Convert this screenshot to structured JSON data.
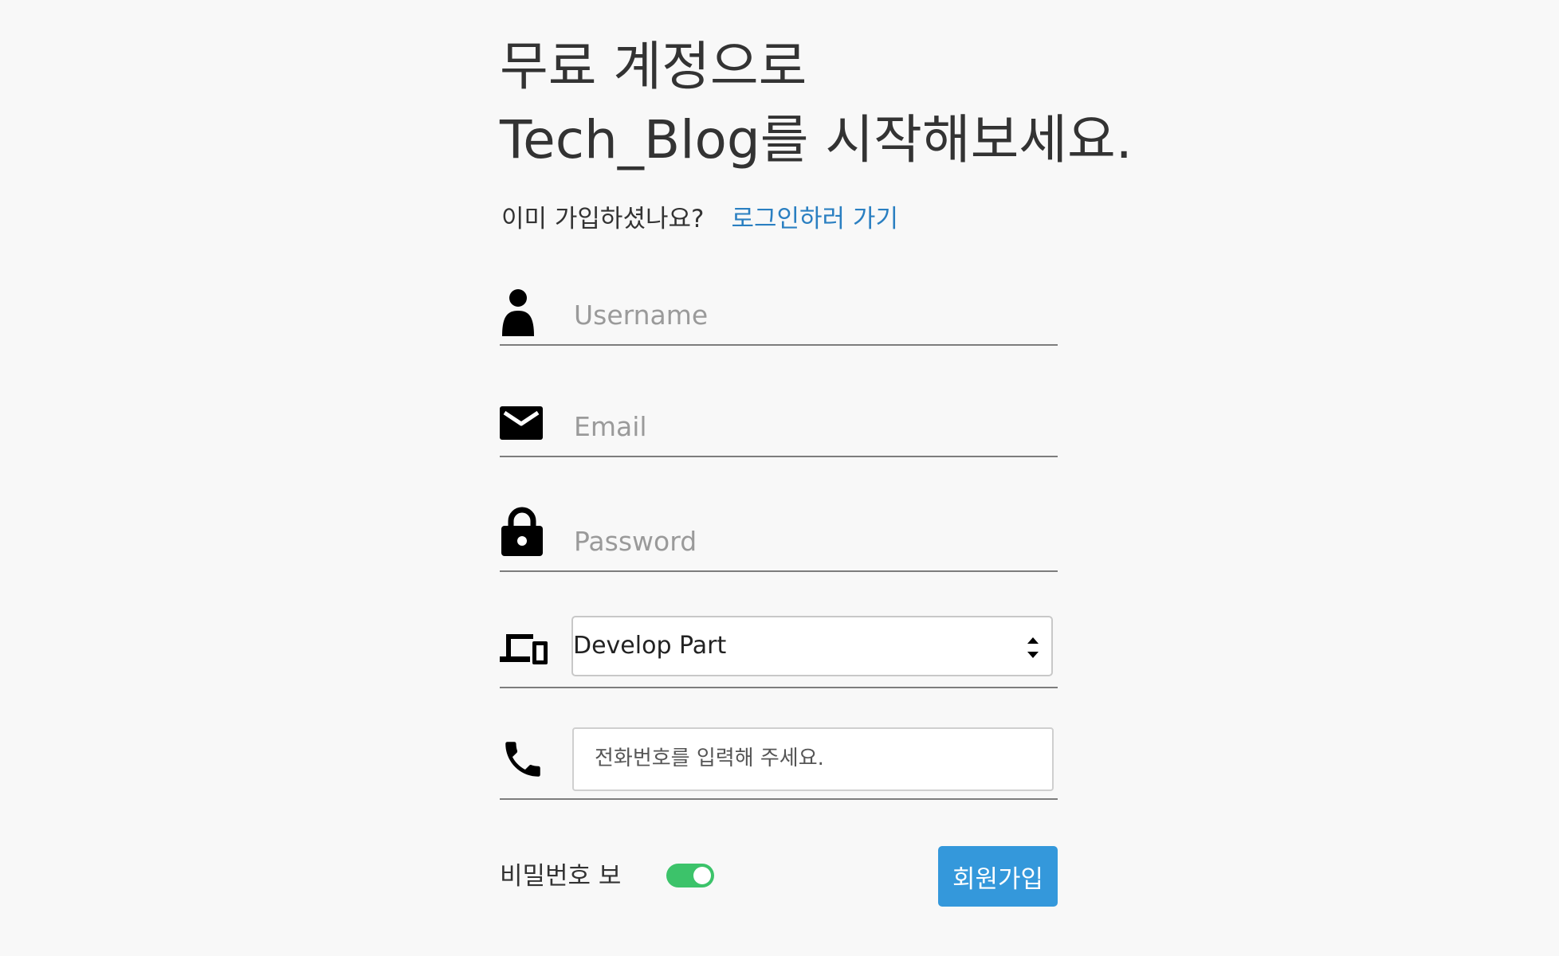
{
  "header": {
    "title_line1": "무료 계정으로",
    "title_line2": "Tech_Blog를 시작해보세요."
  },
  "login_prompt": {
    "question": "이미 가입하셨나요?",
    "link_label": "로그인하러 가기"
  },
  "form": {
    "username": {
      "placeholder": "Username",
      "value": "",
      "icon": "user-icon"
    },
    "email": {
      "placeholder": "Email",
      "value": "",
      "icon": "envelope-icon"
    },
    "password": {
      "placeholder": "Password",
      "value": "",
      "icon": "lock-icon"
    },
    "part": {
      "selected": "Develop Part",
      "icon": "devices-icon"
    },
    "phone": {
      "placeholder": "전화번호를 입력해 주세요.",
      "value": "",
      "icon": "phone-icon"
    }
  },
  "footer": {
    "show_password_label": "비밀번호 보",
    "show_password_on": true,
    "submit_label": "회원가입"
  },
  "colors": {
    "background": "#f8f8f8",
    "link": "#2a7fc1",
    "toggle_on": "#3cc36a",
    "button": "#3498db",
    "underline": "#7d7d7d"
  }
}
